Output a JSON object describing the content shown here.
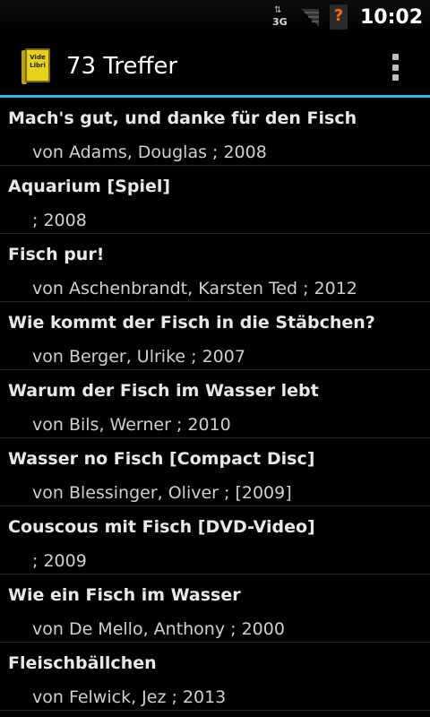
{
  "status_bar": {
    "network_label": "3G",
    "network_icon": "3g-data-icon",
    "signal_icon": "signal-strength-icon",
    "sim_icon": "no-sim-icon",
    "time": "10:02"
  },
  "action_bar": {
    "app_icon": "videlibri-book-icon",
    "app_icon_text": "Vide Libri",
    "title": "73 Treffer",
    "overflow_icon": "overflow-menu-icon",
    "accent_color": "#33b5e5"
  },
  "results": [
    {
      "title": "Mach's gut, und danke für den Fisch",
      "subtitle": "von Adams, Douglas ; 2008"
    },
    {
      "title": "Aquarium [Spiel]",
      "subtitle": "; 2008"
    },
    {
      "title": "Fisch pur!",
      "subtitle": "von Aschenbrandt, Karsten Ted ; 2012"
    },
    {
      "title": "Wie kommt der Fisch in die Stäbchen?",
      "subtitle": "von Berger, Ulrike ; 2007"
    },
    {
      "title": "Warum der Fisch im Wasser lebt",
      "subtitle": "von Bils, Werner ; 2010"
    },
    {
      "title": "Wasser no Fisch [Compact Disc]",
      "subtitle": "von Blessinger, Oliver ; [2009]"
    },
    {
      "title": "Couscous mit Fisch [DVD-Video]",
      "subtitle": "; 2009"
    },
    {
      "title": "Wie ein Fisch im Wasser",
      "subtitle": "von De Mello, Anthony ; 2000"
    },
    {
      "title": "Fleischbällchen",
      "subtitle": "von Felwick, Jez ; 2013"
    }
  ]
}
